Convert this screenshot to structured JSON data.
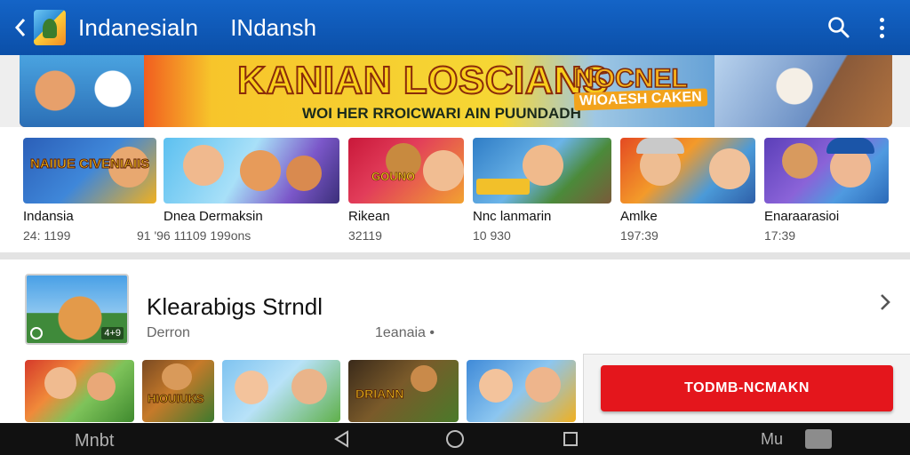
{
  "header": {
    "title": "Indanesialn",
    "subtitle": "INdansh",
    "icons": [
      "back-arrow-icon",
      "app-logo",
      "search-icon",
      "more-vert-icon"
    ]
  },
  "banner": {
    "title": "KANIAN LOSCIANS",
    "subtitle": "WOI HER RROICWARI AIN PUUNDADH",
    "right_title": "NOCNEL",
    "right_subtitle": "WIOAESH CAKEN"
  },
  "top_games": [
    {
      "name": "Indansia",
      "meta": "24: 1199",
      "art": "NAIIUE CIVENIAIIS"
    },
    {
      "name": "Dnea Dermaksin",
      "meta": "91 '96  11109 199ons",
      "art": ""
    },
    {
      "name": "Rikean",
      "meta": "32119",
      "art": "GOUNO"
    },
    {
      "name": "Nnc lanmarin",
      "meta": "10 930",
      "art": ""
    },
    {
      "name": "Amlke",
      "meta": "197:39",
      "art": ""
    },
    {
      "name": "Enaraarasioi",
      "meta": "17:39",
      "art": ""
    }
  ],
  "featured": {
    "title": "Klearabigs Strndl",
    "developer": "Derron",
    "meta": "1eanaia •",
    "badge": "4+9"
  },
  "more_games": [
    {
      "art": ""
    },
    {
      "art": "HIOUIUKS"
    },
    {
      "art": ""
    },
    {
      "art": "DRIANN"
    },
    {
      "art": ""
    }
  ],
  "install_button": "TODMB-NCMAKN",
  "navbar": {
    "left_text": "Mnbt",
    "right_text": "Mu"
  },
  "colors": {
    "app_bar": "#0b4fa8",
    "install_button": "#e4161c",
    "navbar": "#111111"
  }
}
